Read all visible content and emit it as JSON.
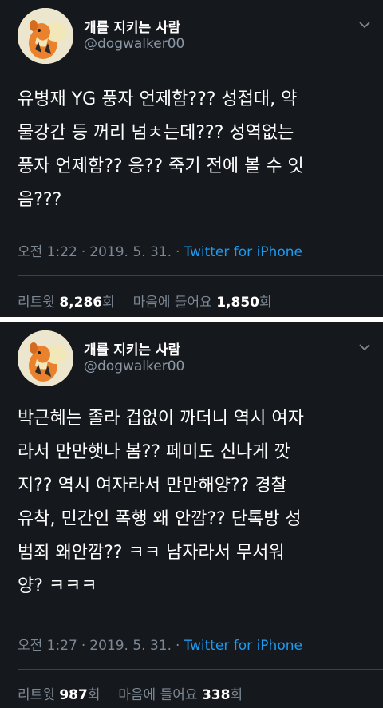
{
  "tweets": [
    {
      "user": {
        "name": "개를 지키는 사람",
        "handle": "@dogwalker00",
        "avatar": "growlithe-avatar"
      },
      "text": "유병재 YG 풍자 언제함??? 성접대, 약\n물강간 등 꺼리 넘ㅊ는데??? 성역없는\n풍자 언제함?? 응?? 죽기 전에 볼 수 잇\n음???",
      "time": "오전 1:22",
      "date": "2019. 5. 31.",
      "source": "Twitter for iPhone",
      "retweet_label": "리트윗",
      "retweet_count": "8,286",
      "count_suffix": "회",
      "like_label": "마음에 들어요",
      "like_count": "1,850"
    },
    {
      "user": {
        "name": "개를 지키는 사람",
        "handle": "@dogwalker00",
        "avatar": "growlithe-avatar"
      },
      "text": "박근혜는 졸라 겁없이 까더니 역시 여자\n라서 만만햇나 봄?? 페미도 신나게 깟\n지?? 역시 여자라서 만만해양?? 경찰\n유착, 민간인 폭행 왜 안깜?? 단톡방 성\n범죄 왜안깜?? ㅋㅋ 남자라서 무서워\n양? ㅋㅋㅋ",
      "time": "오전 1:27",
      "date": "2019. 5. 31.",
      "source": "Twitter for iPhone",
      "retweet_label": "리트윗",
      "retweet_count": "987",
      "count_suffix": "회",
      "like_label": "마음에 들어요",
      "like_count": "338"
    }
  ],
  "colors": {
    "background": "#15181c",
    "text": "#ffffff",
    "muted": "#7d8893",
    "link": "#1d9bf0",
    "divider": "#38444d"
  },
  "icons": {
    "caret": "chevron-down-icon"
  }
}
